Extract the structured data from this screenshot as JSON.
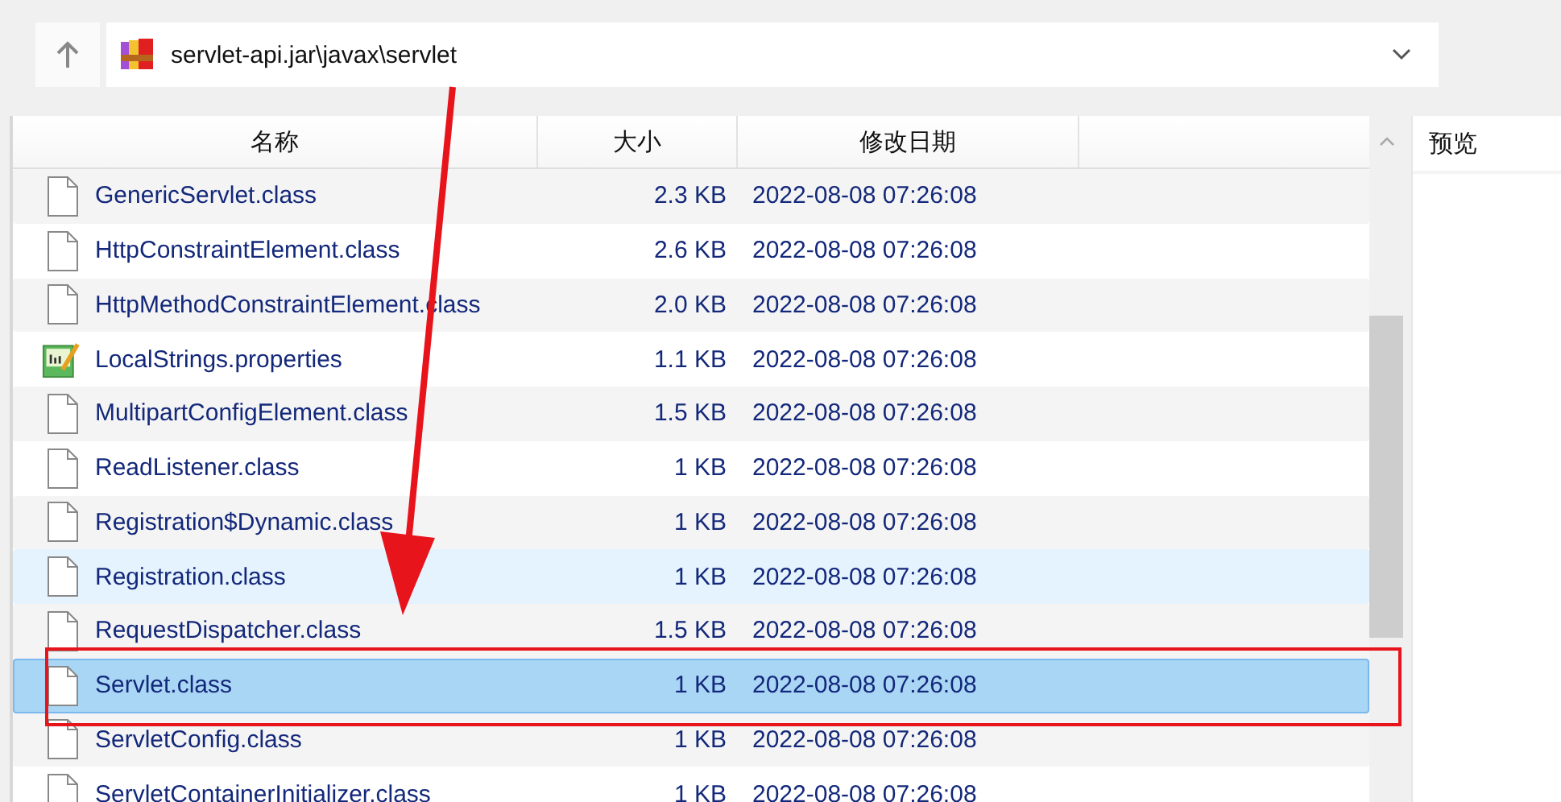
{
  "address_bar": {
    "path": "servlet-api.jar\\javax\\servlet"
  },
  "table": {
    "columns": [
      "名称",
      "大小",
      "修改日期"
    ],
    "rows": [
      {
        "kind": "class",
        "name": "GenericServlet.class",
        "size": "2.3 KB",
        "modified": "2022-08-08 07:26:08",
        "selected": false,
        "hovered": false
      },
      {
        "kind": "class",
        "name": "HttpConstraintElement.class",
        "size": "2.6 KB",
        "modified": "2022-08-08 07:26:08",
        "selected": false,
        "hovered": false
      },
      {
        "kind": "class",
        "name": "HttpMethodConstraintElement.class",
        "size": "2.0 KB",
        "modified": "2022-08-08 07:26:08",
        "selected": false,
        "hovered": false
      },
      {
        "kind": "properties",
        "name": "LocalStrings.properties",
        "size": "1.1 KB",
        "modified": "2022-08-08 07:26:08",
        "selected": false,
        "hovered": false
      },
      {
        "kind": "class",
        "name": "MultipartConfigElement.class",
        "size": "1.5 KB",
        "modified": "2022-08-08 07:26:08",
        "selected": false,
        "hovered": false
      },
      {
        "kind": "class",
        "name": "ReadListener.class",
        "size": "1 KB",
        "modified": "2022-08-08 07:26:08",
        "selected": false,
        "hovered": false
      },
      {
        "kind": "class",
        "name": "Registration$Dynamic.class",
        "size": "1 KB",
        "modified": "2022-08-08 07:26:08",
        "selected": false,
        "hovered": false
      },
      {
        "kind": "class",
        "name": "Registration.class",
        "size": "1 KB",
        "modified": "2022-08-08 07:26:08",
        "selected": false,
        "hovered": true
      },
      {
        "kind": "class",
        "name": "RequestDispatcher.class",
        "size": "1.5 KB",
        "modified": "2022-08-08 07:26:08",
        "selected": false,
        "hovered": false
      },
      {
        "kind": "class",
        "name": "Servlet.class",
        "size": "1 KB",
        "modified": "2022-08-08 07:26:08",
        "selected": true,
        "hovered": false
      },
      {
        "kind": "class",
        "name": "ServletConfig.class",
        "size": "1 KB",
        "modified": "2022-08-08 07:26:08",
        "selected": false,
        "hovered": false
      },
      {
        "kind": "class",
        "name": "ServletContainerInitializer.class",
        "size": "1 KB",
        "modified": "2022-08-08 07:26:08",
        "selected": false,
        "hovered": false
      }
    ]
  },
  "preview_pane": {
    "title": "预览"
  }
}
